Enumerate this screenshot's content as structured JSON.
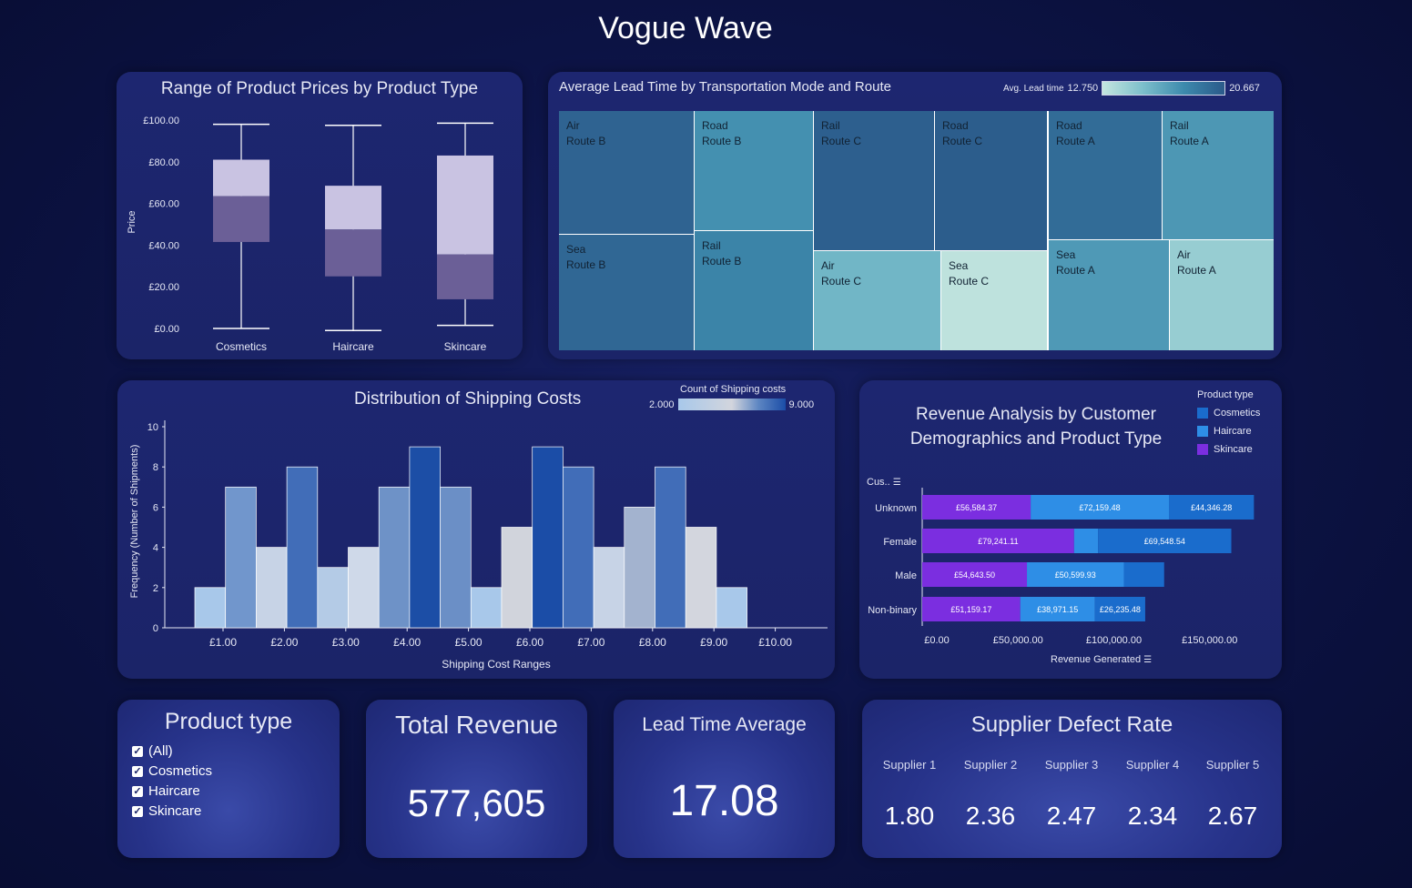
{
  "dashboard": {
    "title": "Vogue Wave"
  },
  "boxplot": {
    "title": "Range of Product Prices by Product Type",
    "ylabel": "Price",
    "yticks": [
      "£100.00",
      "£80.00",
      "£60.00",
      "£40.00",
      "£20.00",
      "£0.00"
    ],
    "categories": [
      "Cosmetics",
      "Haircare",
      "Skincare"
    ]
  },
  "treemap": {
    "title": "Average Lead Time by Transportation Mode and Route",
    "legend_label": "Avg. Lead time",
    "legend_min": "12.750",
    "legend_max": "20.667",
    "cells": [
      {
        "mode": "Air",
        "route": "Route B"
      },
      {
        "mode": "Road",
        "route": "Route B"
      },
      {
        "mode": "Sea",
        "route": "Route B"
      },
      {
        "mode": "Rail",
        "route": "Route B"
      },
      {
        "mode": "Rail",
        "route": "Route C"
      },
      {
        "mode": "Road",
        "route": "Route C"
      },
      {
        "mode": "Air",
        "route": "Route C"
      },
      {
        "mode": "Sea",
        "route": "Route C"
      },
      {
        "mode": "Road",
        "route": "Route A"
      },
      {
        "mode": "Rail",
        "route": "Route A"
      },
      {
        "mode": "Sea",
        "route": "Route A"
      },
      {
        "mode": "Air",
        "route": "Route A"
      }
    ]
  },
  "histogram": {
    "title": "Distribution of Shipping Costs",
    "legend_label": "Count of Shipping costs",
    "legend_min": "2.000",
    "legend_max": "9.000",
    "xlabel": "Shipping Cost Ranges",
    "ylabel": "Frequency (Number of Shipments)",
    "yticks": [
      "10",
      "8",
      "6",
      "4",
      "2",
      "0"
    ],
    "xticks": [
      "£1.00",
      "£2.00",
      "£3.00",
      "£4.00",
      "£5.00",
      "£6.00",
      "£7.00",
      "£8.00",
      "£9.00",
      "£10.00"
    ]
  },
  "revenue": {
    "title_line1": "Revenue Analysis by Customer",
    "title_line2": "Demographics and Product Type",
    "legend_title": "Product type",
    "legend": [
      "Cosmetics",
      "Haircare",
      "Skincare"
    ],
    "row_header": "Cus..",
    "xlabel": "Revenue Generated",
    "xticks": [
      "£0.00",
      "£50,000.00",
      "£100,000.00",
      "£150,000.00"
    ]
  },
  "filter": {
    "title": "Product type",
    "options": [
      "(All)",
      "Cosmetics",
      "Haircare",
      "Skincare"
    ]
  },
  "kpi_revenue": {
    "title": "Total Revenue",
    "value": "577,605"
  },
  "kpi_lead": {
    "title": "Lead Time Average",
    "value": "17.08"
  },
  "defects": {
    "title": "Supplier Defect Rate",
    "suppliers": [
      {
        "name": "Supplier 1",
        "value": "1.80"
      },
      {
        "name": "Supplier 2",
        "value": "2.36"
      },
      {
        "name": "Supplier 3",
        "value": "2.47"
      },
      {
        "name": "Supplier 4",
        "value": "2.34"
      },
      {
        "name": "Supplier 5",
        "value": "2.67"
      }
    ]
  },
  "colors": {
    "skincare": "#7b2ee0",
    "haircare": "#2e8ee6",
    "cosmetics": "#1a6ccc",
    "box_upper": "#c9c3e2",
    "box_lower": "#6b5f97"
  },
  "chart_data": [
    {
      "type": "boxplot",
      "title": "Range of Product Prices by Product Type",
      "ylabel": "Price",
      "ylim": [
        0,
        100
      ],
      "categories": [
        "Cosmetics",
        "Haircare",
        "Skincare"
      ],
      "whisker_low": [
        0,
        -1,
        1.5
      ],
      "q1": [
        41.5,
        25,
        14
      ],
      "median": [
        63.5,
        47.5,
        35.5
      ],
      "q3": [
        81,
        68.5,
        83
      ],
      "whisker_high": [
        98,
        97.5,
        98.5
      ]
    },
    {
      "type": "treemap",
      "title": "Average Lead Time by Transportation Mode and Route",
      "colorscale": [
        12.75,
        20.667
      ],
      "cells": [
        {
          "mode": "Air",
          "route": "Route B",
          "value": 20.2
        },
        {
          "mode": "Road",
          "route": "Route B",
          "value": 18.0
        },
        {
          "mode": "Sea",
          "route": "Route B",
          "value": 20.0
        },
        {
          "mode": "Rail",
          "route": "Route B",
          "value": 18.6
        },
        {
          "mode": "Rail",
          "route": "Route C",
          "value": 20.4
        },
        {
          "mode": "Road",
          "route": "Route C",
          "value": 20.5
        },
        {
          "mode": "Air",
          "route": "Route C",
          "value": 16.0
        },
        {
          "mode": "Sea",
          "route": "Route C",
          "value": 13.0
        },
        {
          "mode": "Road",
          "route": "Route A",
          "value": 19.8
        },
        {
          "mode": "Rail",
          "route": "Route A",
          "value": 17.6
        },
        {
          "mode": "Sea",
          "route": "Route A",
          "value": 17.5
        },
        {
          "mode": "Air",
          "route": "Route A",
          "value": 14.5
        }
      ]
    },
    {
      "type": "bar",
      "title": "Distribution of Shipping Costs",
      "xlabel": "Shipping Cost Ranges",
      "ylabel": "Frequency (Number of Shipments)",
      "ylim": [
        0,
        10
      ],
      "bins_x": [
        1.0,
        1.5,
        2.0,
        2.5,
        3.0,
        3.5,
        4.0,
        4.5,
        5.0,
        5.5,
        6.0,
        6.5,
        7.0,
        7.5,
        8.0,
        8.5,
        9.0,
        9.5,
        10.0
      ],
      "values": [
        2,
        7,
        4,
        8,
        3,
        4,
        7,
        9,
        7,
        2,
        5,
        9,
        8,
        4,
        6,
        8,
        5,
        2
      ],
      "colors": [
        "#a8c8ea",
        "#7196cc",
        "#c7d3e6",
        "#416db8",
        "#b4cbe6",
        "#cfd9e9",
        "#6e92c7",
        "#1c4ea6",
        "#6b8fc6",
        "#a8c8ea",
        "#d1d4dc",
        "#1b4da7",
        "#416db8",
        "#c7d3e6",
        "#a3b3cf",
        "#416db8",
        "#d3d6de",
        "#a8c8ea"
      ]
    },
    {
      "type": "bar",
      "orientation": "horizontal",
      "title": "Revenue Analysis by Customer Demographics and Product Type",
      "xlabel": "Revenue Generated",
      "categories": [
        "Unknown",
        "Female",
        "Male",
        "Non-binary"
      ],
      "series": [
        {
          "name": "Skincare",
          "values": [
            56584.37,
            79241.11,
            54643.5,
            51159.17
          ],
          "labels": [
            "£56,584.37",
            "£79,241.11",
            "£54,643.50",
            "£51,159.17"
          ]
        },
        {
          "name": "Haircare",
          "values": [
            72159.48,
            12500,
            50599.93,
            38971.15
          ],
          "labels": [
            "£72,159.48",
            "",
            "£50,599.93",
            "£38,971.15"
          ]
        },
        {
          "name": "Cosmetics",
          "values": [
            44346.28,
            69548.54,
            21000,
            26235.48
          ],
          "labels": [
            "£44,346.28",
            "£69,548.54",
            "",
            "£26,235.48"
          ]
        }
      ]
    }
  ]
}
